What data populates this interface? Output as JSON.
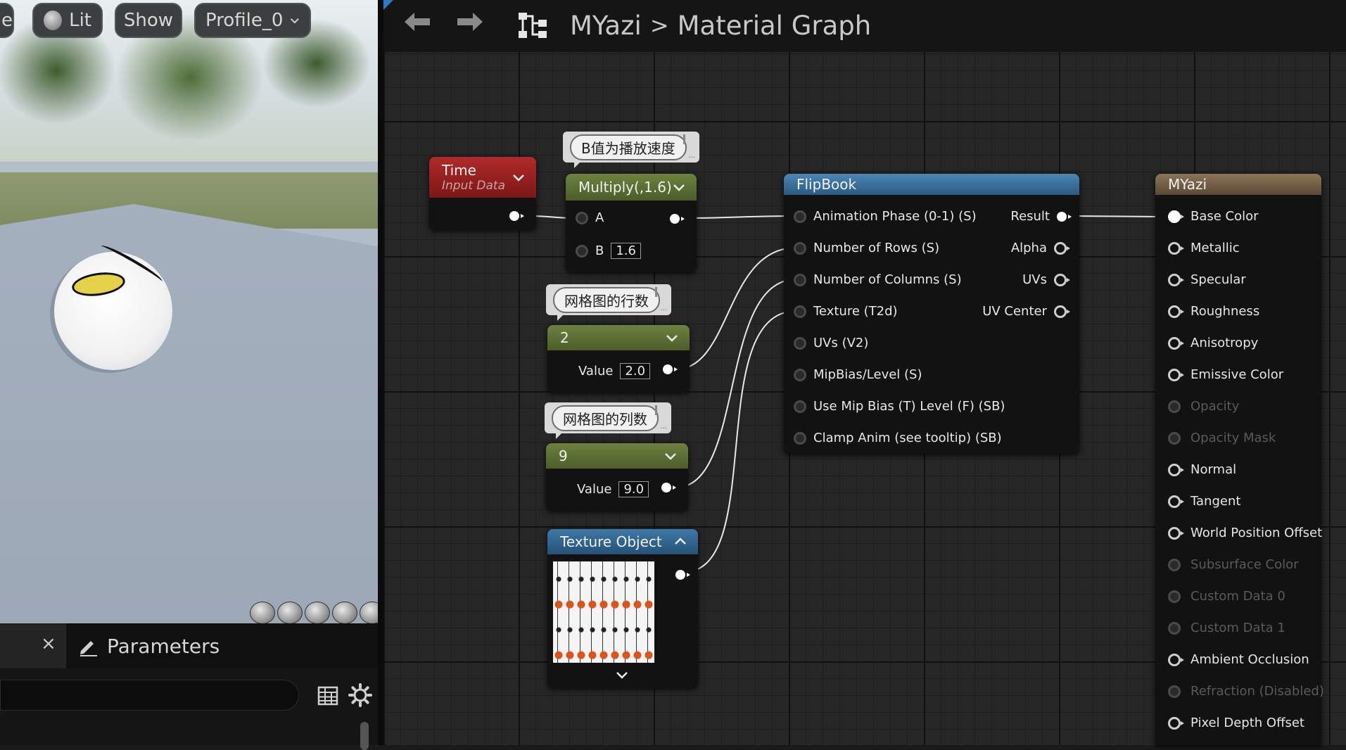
{
  "viewport": {
    "pill_partial": "e",
    "lit_label": "Lit",
    "show_label": "Show",
    "profile_label": "Profile_0"
  },
  "parameters_panel": {
    "close_glyph": "×",
    "tab_label": "Parameters",
    "search_value": ""
  },
  "toolbar": {
    "back_glyph": "⬅",
    "forward_glyph": "➡",
    "breadcrumb_root": "MYazi",
    "breadcrumb_separator": ">",
    "breadcrumb_current": "Material Graph"
  },
  "nodes": {
    "time": {
      "title": "Time",
      "subtitle": "Input Data",
      "header_color": "#8b1c1c"
    },
    "multiply": {
      "title": "Multiply(,1.6)",
      "comment": "B值为播放速度",
      "input_a": "A",
      "input_b": "B",
      "b_value": "1.6",
      "header_color": "#5b6e34"
    },
    "rows_const": {
      "comment": "网格图的行数",
      "title": "2",
      "value_label": "Value",
      "value": "2.0",
      "header_color": "#5b6e34"
    },
    "cols_const": {
      "comment": "网格图的列数",
      "title": "9",
      "value_label": "Value",
      "value": "9.0",
      "header_color": "#5b6e34"
    },
    "texture_object": {
      "title": "Texture Object",
      "header_color": "#2e5f86"
    },
    "flipbook": {
      "title": "FlipBook",
      "header_color": "#2e5f86",
      "inputs": [
        "Animation  Phase (0-1) (S)",
        "Number of Rows (S)",
        "Number of Columns (S)",
        "Texture (T2d)",
        "UVs (V2)",
        "MipBias/Level (S)",
        "Use Mip Bias (T) Level (F) (SB)",
        "Clamp Anim (see tooltip) (SB)"
      ],
      "outputs": [
        "Result",
        "Alpha",
        "UVs",
        "UV Center"
      ]
    },
    "material": {
      "title": "MYazi",
      "header_color": "#6e5b45",
      "inputs": [
        {
          "label": "Base Color",
          "enabled": true,
          "connected": true
        },
        {
          "label": "Metallic",
          "enabled": true,
          "connected": false
        },
        {
          "label": "Specular",
          "enabled": true,
          "connected": false
        },
        {
          "label": "Roughness",
          "enabled": true,
          "connected": false
        },
        {
          "label": "Anisotropy",
          "enabled": true,
          "connected": false
        },
        {
          "label": "Emissive Color",
          "enabled": true,
          "connected": false
        },
        {
          "label": "Opacity",
          "enabled": false,
          "connected": false
        },
        {
          "label": "Opacity Mask",
          "enabled": false,
          "connected": false
        },
        {
          "label": "Normal",
          "enabled": true,
          "connected": false
        },
        {
          "label": "Tangent",
          "enabled": true,
          "connected": false
        },
        {
          "label": "World Position Offset",
          "enabled": true,
          "connected": false
        },
        {
          "label": "Subsurface Color",
          "enabled": false,
          "connected": false
        },
        {
          "label": "Custom Data 0",
          "enabled": false,
          "connected": false
        },
        {
          "label": "Custom Data 1",
          "enabled": false,
          "connected": false
        },
        {
          "label": "Ambient Occlusion",
          "enabled": true,
          "connected": false
        },
        {
          "label": "Refraction (Disabled)",
          "enabled": false,
          "connected": false
        },
        {
          "label": "Pixel Depth Offset",
          "enabled": true,
          "connected": false
        }
      ]
    }
  },
  "colors": {
    "disabled_text": "#5a5a5a",
    "wire": "#e8e8e8"
  }
}
